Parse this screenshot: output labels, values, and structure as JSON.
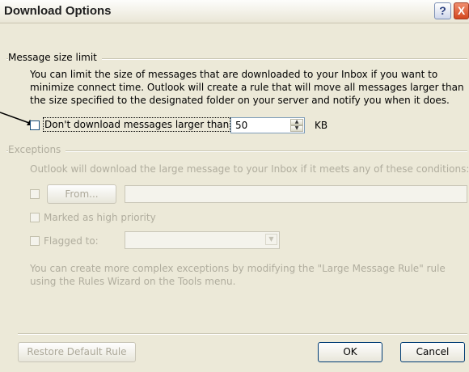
{
  "window": {
    "title": "Download Options",
    "help_label": "?",
    "close_label": "X"
  },
  "message_size": {
    "group_label": "Message size limit",
    "description": "You can limit the size of messages that are downloaded to your Inbox if you want to minimize connect time. Outlook will create a rule that will move all messages larger than the size specified to the designated folder on your server and notify you when it does.",
    "checkbox_label": "Don't download messages larger than",
    "checked": false,
    "size_value": "50",
    "unit": "KB"
  },
  "exceptions": {
    "group_label": "Exceptions",
    "description": "Outlook will download the large message to your Inbox if it meets any of these conditions:",
    "from_button": "From...",
    "from_value": "",
    "high_priority_label": "Marked as high priority",
    "flagged_label": "Flagged to:",
    "flagged_value": "",
    "footer_note": "You can create more complex exceptions by modifying the \"Large Message Rule\" rule using the Rules Wizard on the Tools menu."
  },
  "buttons": {
    "restore": "Restore Default Rule",
    "ok": "OK",
    "cancel": "Cancel"
  }
}
